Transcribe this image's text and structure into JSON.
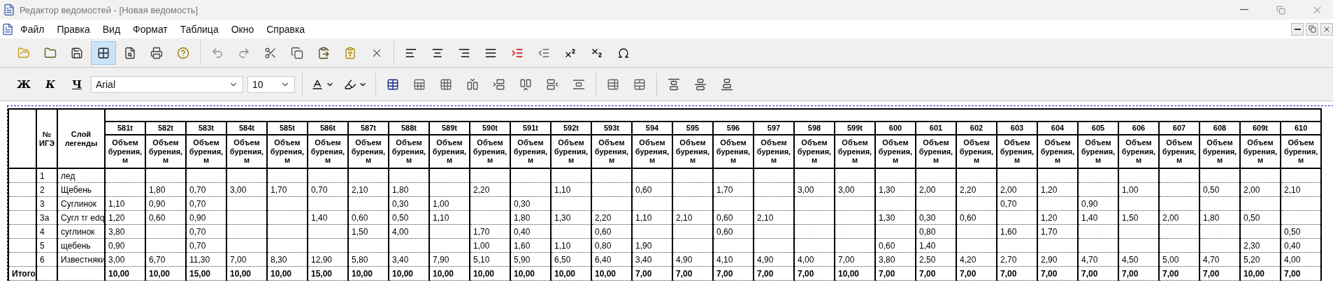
{
  "window": {
    "title": "Редактор ведомостей - [Новая ведомость]"
  },
  "menu": [
    "Файл",
    "Правка",
    "Вид",
    "Формат",
    "Таблица",
    "Окно",
    "Справка"
  ],
  "toolbar": {
    "groups": [
      [
        {
          "kind": "open",
          "pressed": false
        },
        {
          "kind": "open_recent",
          "pressed": false
        },
        {
          "kind": "save",
          "pressed": false
        },
        {
          "kind": "grid",
          "pressed": true
        },
        {
          "kind": "preview",
          "pressed": false
        },
        {
          "kind": "print",
          "pressed": false
        },
        {
          "kind": "help",
          "pressed": false
        }
      ],
      [
        {
          "kind": "undo",
          "pressed": false
        },
        {
          "kind": "redo",
          "pressed": false
        },
        {
          "kind": "cut",
          "pressed": false
        },
        {
          "kind": "copy",
          "pressed": false
        },
        {
          "kind": "paste",
          "pressed": false
        },
        {
          "kind": "paste_format",
          "pressed": false
        },
        {
          "kind": "delete",
          "pressed": false
        }
      ],
      [
        {
          "kind": "align_left",
          "pressed": false
        },
        {
          "kind": "align_center",
          "pressed": false
        },
        {
          "kind": "align_right",
          "pressed": false
        },
        {
          "kind": "justify",
          "pressed": false
        },
        {
          "kind": "indent",
          "pressed": false
        },
        {
          "kind": "outdent",
          "pressed": false
        },
        {
          "kind": "superscript",
          "pressed": false
        },
        {
          "kind": "subscript",
          "pressed": false
        },
        {
          "kind": "special_char",
          "pressed": false
        }
      ]
    ]
  },
  "format_bar": {
    "style_buttons": [
      {
        "label": "Ж",
        "kind": "bold"
      },
      {
        "label": "К",
        "kind": "italic"
      },
      {
        "label": "Ч",
        "kind": "underline"
      }
    ],
    "font": "Arial",
    "size": "10",
    "groups": [
      [
        {
          "kind": "font_color"
        },
        {
          "kind": "highlight"
        }
      ],
      [
        {
          "kind": "table"
        },
        {
          "kind": "cells"
        },
        {
          "kind": "grid_cells"
        },
        {
          "kind": "insert_col_left"
        },
        {
          "kind": "insert_row_above"
        },
        {
          "kind": "insert_col_right"
        },
        {
          "kind": "insert_row_below"
        },
        {
          "kind": "row_height"
        }
      ],
      [
        {
          "kind": "cell_props"
        },
        {
          "kind": "table_props"
        }
      ],
      [
        {
          "kind": "valign_top"
        },
        {
          "kind": "valign_middle"
        },
        {
          "kind": "valign_bottom"
        }
      ]
    ]
  },
  "table": {
    "headers": [
      "№ ИГЭ",
      "Слой легенды"
    ],
    "columns": [
      {
        "id": "581t",
        "label": "Объем бурения, м"
      },
      {
        "id": "582t",
        "label": "Объем бурения, м"
      },
      {
        "id": "583t",
        "label": "Объем бурения, м"
      },
      {
        "id": "584t",
        "label": "Объем бурения, м"
      },
      {
        "id": "585t",
        "label": "Объем бурения, м"
      },
      {
        "id": "586t",
        "label": "Объем бурения, м"
      },
      {
        "id": "587t",
        "label": "Объем бурения, м"
      },
      {
        "id": "588t",
        "label": "Объем бурения, м"
      },
      {
        "id": "589t",
        "label": "Объем бурения, м"
      },
      {
        "id": "590t",
        "label": "Объем бурения, м"
      },
      {
        "id": "591t",
        "label": "Объем бурения, м"
      },
      {
        "id": "592t",
        "label": "Объем бурения, м"
      },
      {
        "id": "593t",
        "label": "Объем бурения, м"
      },
      {
        "id": "594",
        "label": "Объем бурения, м"
      },
      {
        "id": "595",
        "label": "Объем бурения, м"
      },
      {
        "id": "596",
        "label": "Объем бурения, м"
      },
      {
        "id": "597",
        "label": "Объем бурения, м"
      },
      {
        "id": "598",
        "label": "Объем бурения, м"
      },
      {
        "id": "599t",
        "label": "Объем бурения, м"
      },
      {
        "id": "600",
        "label": "Объем бурения, м"
      },
      {
        "id": "601",
        "label": "Объем бурения, м"
      },
      {
        "id": "602",
        "label": "Объем бурения, м"
      },
      {
        "id": "603",
        "label": "Объем бурения, м"
      },
      {
        "id": "604",
        "label": "Объем бурения, м"
      },
      {
        "id": "605",
        "label": "Объем бурения, м"
      },
      {
        "id": "606",
        "label": "Объем бурения, м"
      },
      {
        "id": "607",
        "label": "Объем бурения, м"
      },
      {
        "id": "608",
        "label": "Объем бурения, м"
      },
      {
        "id": "609t",
        "label": "Объем бурения, м"
      },
      {
        "id": "610",
        "label": "Объем бурения, м"
      }
    ],
    "rows": [
      {
        "number": "1",
        "layer": "лед",
        "cells": [
          {
            "empty": true
          },
          {
            "empty": true
          },
          {
            "empty": true
          },
          {
            "empty": true
          },
          {
            "empty": true
          },
          {
            "empty": true
          },
          {
            "empty": true
          },
          {
            "empty": true
          },
          {
            "empty": true
          },
          {
            "empty": true
          },
          {
            "empty": true
          },
          {
            "empty": true
          },
          {
            "empty": true
          },
          {
            "empty": true
          },
          {
            "empty": true
          },
          {
            "empty": true
          },
          {
            "empty": true
          },
          {
            "empty": true
          },
          {
            "empty": true
          },
          {
            "empty": true
          },
          {
            "empty": true
          },
          {
            "empty": true
          },
          {
            "empty": true
          },
          {
            "empty": true
          },
          {
            "empty": true
          },
          {
            "empty": true
          },
          {
            "empty": true
          },
          {
            "empty": true
          },
          {
            "empty": true
          },
          {
            "empty": true
          }
        ]
      },
      {
        "number": "2",
        "layer": "Щебень",
        "cells": [
          {
            "empty": true
          },
          {
            "value": "1,80"
          },
          {
            "value": "0,70"
          },
          {
            "value": "3,00"
          },
          {
            "value": "1,70"
          },
          {
            "value": "0,70"
          },
          {
            "value": "2,10"
          },
          {
            "value": "1,80"
          },
          {
            "empty": true
          },
          {
            "value": "2,20"
          },
          {
            "empty": true
          },
          {
            "value": "1,10"
          },
          {
            "empty": true
          },
          {
            "value": "0,60"
          },
          {
            "empty": true
          },
          {
            "value": "1,70"
          },
          {
            "empty": true
          },
          {
            "value": "3,00"
          },
          {
            "value": "3,00"
          },
          {
            "value": "1,30"
          },
          {
            "value": "2,00"
          },
          {
            "value": "2,20"
          },
          {
            "value": "2,00"
          },
          {
            "value": "1,20"
          },
          {
            "empty": true
          },
          {
            "value": "1,00"
          },
          {
            "empty": true
          },
          {
            "value": "0,50"
          },
          {
            "value": "2,00"
          },
          {
            "value": "2,10"
          }
        ]
      },
      {
        "number": "3",
        "layer": "Суглинок",
        "cells": [
          {
            "value": "1,10"
          },
          {
            "value": "0,90"
          },
          {
            "value": "0,70"
          },
          {
            "empty": true
          },
          {
            "empty": true
          },
          {
            "empty": true
          },
          {
            "empty": true
          },
          {
            "value": "0,30"
          },
          {
            "value": "1,00"
          },
          {
            "empty": true
          },
          {
            "value": "0,30"
          },
          {
            "empty": true
          },
          {
            "empty": true
          },
          {
            "empty": true
          },
          {
            "empty": true
          },
          {
            "empty": true
          },
          {
            "empty": true
          },
          {
            "empty": true
          },
          {
            "empty": true
          },
          {
            "empty": true
          },
          {
            "empty": true
          },
          {
            "empty": true
          },
          {
            "value": "0,70"
          },
          {
            "empty": true
          },
          {
            "value": "0,90"
          },
          {
            "empty": true
          },
          {
            "empty": true
          },
          {
            "empty": true
          },
          {
            "empty": true
          },
          {
            "empty": true
          }
        ]
      },
      {
        "number": "3а",
        "layer": "Сугл тг edq",
        "cells": [
          {
            "value": "1,20"
          },
          {
            "value": "0,60"
          },
          {
            "value": "0,90"
          },
          {
            "empty": true
          },
          {
            "empty": true
          },
          {
            "value": "1,40"
          },
          {
            "value": "0,60"
          },
          {
            "value": "0,50"
          },
          {
            "value": "1,10"
          },
          {
            "empty": true
          },
          {
            "value": "1,80"
          },
          {
            "value": "1,30"
          },
          {
            "value": "2,20"
          },
          {
            "value": "1,10"
          },
          {
            "value": "2,10"
          },
          {
            "value": "0,60"
          },
          {
            "value": "2,10"
          },
          {
            "empty": true
          },
          {
            "empty": true
          },
          {
            "value": "1,30"
          },
          {
            "value": "0,30"
          },
          {
            "value": "0,60"
          },
          {
            "empty": true
          },
          {
            "value": "1,20"
          },
          {
            "value": "1,40"
          },
          {
            "value": "1,50"
          },
          {
            "value": "2,00"
          },
          {
            "value": "1,80"
          },
          {
            "value": "0,50"
          },
          {
            "empty": true
          }
        ]
      },
      {
        "number": "4",
        "layer": "суглинок",
        "cells": [
          {
            "value": "3,80"
          },
          {
            "empty": true
          },
          {
            "value": "0,70"
          },
          {
            "empty": true
          },
          {
            "empty": true
          },
          {
            "empty": true
          },
          {
            "value": "1,50"
          },
          {
            "value": "4,00"
          },
          {
            "empty": true
          },
          {
            "value": "1,70"
          },
          {
            "value": "0,40"
          },
          {
            "empty": true
          },
          {
            "value": "0,60"
          },
          {
            "empty": true
          },
          {
            "empty": true
          },
          {
            "value": "0,60"
          },
          {
            "empty": true
          },
          {
            "empty": true
          },
          {
            "empty": true
          },
          {
            "empty": true
          },
          {
            "value": "0,80"
          },
          {
            "empty": true
          },
          {
            "value": "1,60"
          },
          {
            "value": "1,70"
          },
          {
            "empty": true
          },
          {
            "empty": true
          },
          {
            "empty": true
          },
          {
            "empty": true
          },
          {
            "empty": true
          },
          {
            "value": "0,50"
          }
        ]
      },
      {
        "number": "5",
        "layer": "щебень",
        "cells": [
          {
            "value": "0,90"
          },
          {
            "empty": true
          },
          {
            "value": "0,70"
          },
          {
            "empty": true
          },
          {
            "empty": true
          },
          {
            "empty": true
          },
          {
            "empty": true
          },
          {
            "empty": true
          },
          {
            "empty": true
          },
          {
            "value": "1,00"
          },
          {
            "value": "1,60"
          },
          {
            "value": "1,10"
          },
          {
            "value": "0,80"
          },
          {
            "value": "1,90"
          },
          {
            "empty": true
          },
          {
            "empty": true
          },
          {
            "empty": true
          },
          {
            "empty": true
          },
          {
            "empty": true
          },
          {
            "value": "0,60"
          },
          {
            "value": "1,40"
          },
          {
            "empty": true
          },
          {
            "empty": true
          },
          {
            "empty": true
          },
          {
            "empty": true
          },
          {
            "empty": true
          },
          {
            "empty": true
          },
          {
            "empty": true
          },
          {
            "value": "2,30"
          },
          {
            "value": "0,40"
          }
        ]
      },
      {
        "number": "6",
        "layer": "Известняки",
        "cells": [
          {
            "value": "3,00"
          },
          {
            "value": "6,70"
          },
          {
            "value": "11,30"
          },
          {
            "value": "7,00"
          },
          {
            "value": "8,30"
          },
          {
            "value": "12,90"
          },
          {
            "value": "5,80"
          },
          {
            "value": "3,40"
          },
          {
            "value": "7,90"
          },
          {
            "value": "5,10"
          },
          {
            "value": "5,90"
          },
          {
            "value": "6,50"
          },
          {
            "value": "6,40"
          },
          {
            "value": "3,40"
          },
          {
            "value": "4,90"
          },
          {
            "value": "4,10"
          },
          {
            "value": "4,90"
          },
          {
            "value": "4,00"
          },
          {
            "value": "7,00"
          },
          {
            "value": "3,80"
          },
          {
            "value": "2,50"
          },
          {
            "value": "4,20"
          },
          {
            "value": "2,70"
          },
          {
            "value": "2,90"
          },
          {
            "value": "4,70"
          },
          {
            "value": "4,50"
          },
          {
            "value": "5,00"
          },
          {
            "value": "4,70"
          },
          {
            "value": "5,20"
          },
          {
            "value": "4,00"
          }
        ]
      }
    ],
    "total": {
      "label": "Итого",
      "values": [
        "10,00",
        "10,00",
        "15,00",
        "10,00",
        "10,00",
        "15,00",
        "10,00",
        "10,00",
        "10,00",
        "10,00",
        "10,00",
        "10,00",
        "10,00",
        "7,00",
        "7,00",
        "7,00",
        "7,00",
        "7,00",
        "10,00",
        "7,00",
        "7,00",
        "7,00",
        "7,00",
        "7,00",
        "7,00",
        "7,00",
        "7,00",
        "7,00",
        "10,00",
        "7,00"
      ]
    }
  }
}
